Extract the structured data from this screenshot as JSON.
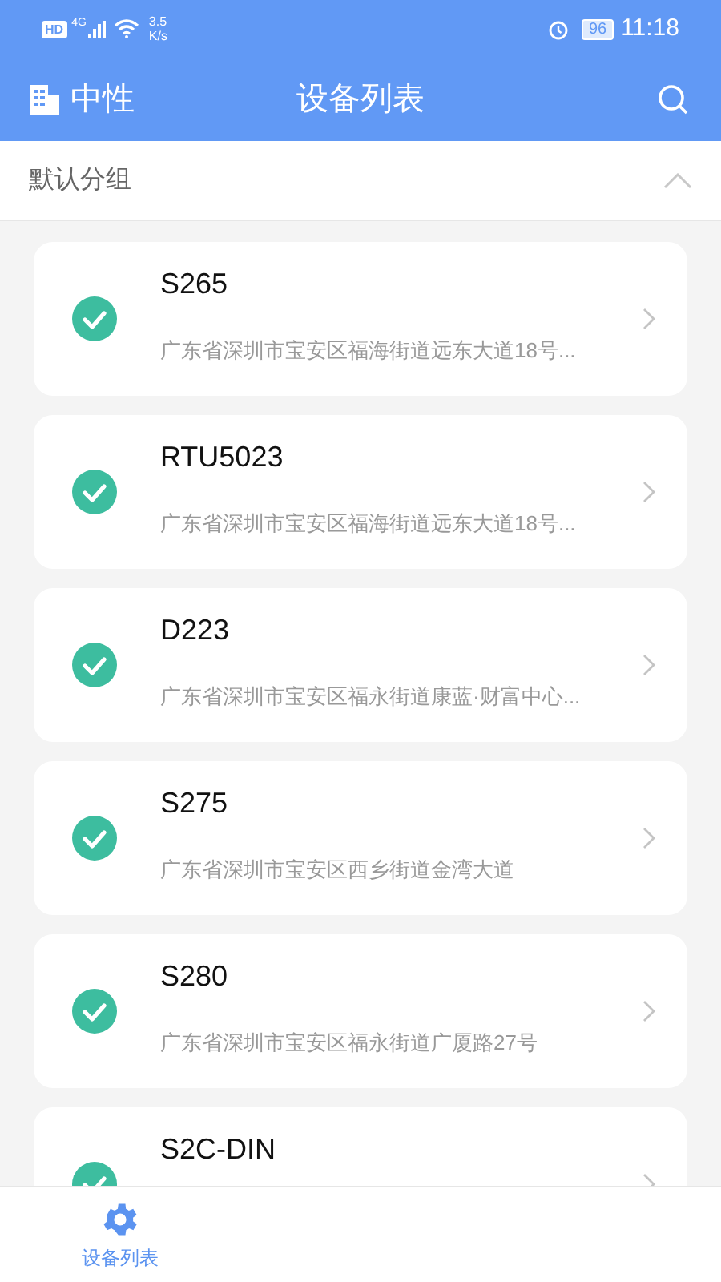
{
  "status_bar": {
    "hd": "HD",
    "network": "4G",
    "speed_value": "3.5",
    "speed_unit": "K/s",
    "battery": "96",
    "time": "11:18"
  },
  "header": {
    "org": "中性",
    "title": "设备列表"
  },
  "group": {
    "name": "默认分组",
    "expanded": true
  },
  "devices": [
    {
      "name": "S265",
      "address": "广东省深圳市宝安区福海街道远东大道18号...",
      "checked": true
    },
    {
      "name": "RTU5023",
      "address": "广东省深圳市宝安区福海街道远东大道18号...",
      "checked": true
    },
    {
      "name": "D223",
      "address": "广东省深圳市宝安区福永街道康蓝·财富中心...",
      "checked": true
    },
    {
      "name": "S275",
      "address": "广东省深圳市宝安区西乡街道金湾大道",
      "checked": true
    },
    {
      "name": "S280",
      "address": "广东省深圳市宝安区福永街道广厦路27号",
      "checked": true
    },
    {
      "name": "S2C-DIN",
      "checked": true
    }
  ],
  "bottom_nav": [
    {
      "label": "设备列表",
      "selected": true
    }
  ]
}
